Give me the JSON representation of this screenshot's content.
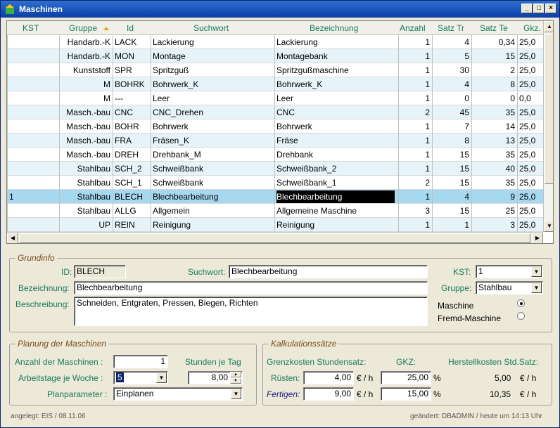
{
  "window": {
    "title": "Maschinen"
  },
  "grid": {
    "headers": [
      "KST",
      "Gruppe",
      "Id",
      "Suchwort",
      "Bezeichnung",
      "Anzahl",
      "Satz Tr",
      "Satz Te",
      "Gkz."
    ],
    "rows": [
      [
        "",
        "Handarb.-K",
        "LACK",
        "Lackierung",
        "Lackierung",
        "1",
        "4",
        "0,34",
        "25,0"
      ],
      [
        "",
        "Handarb.-K",
        "MON",
        "Montage",
        "Montagebank",
        "1",
        "5",
        "15",
        "25,0"
      ],
      [
        "",
        "Kunststoff",
        "SPR",
        "Spritzguß",
        "Spritzgußmaschine",
        "1",
        "30",
        "2",
        "25,0"
      ],
      [
        "",
        "M",
        "BOHRK",
        "Bohrwerk_K",
        "Bohrwerk_K",
        "1",
        "4",
        "8",
        "25,0"
      ],
      [
        "",
        "M",
        "---",
        "Leer",
        "Leer",
        "1",
        "0",
        "0",
        "0,0"
      ],
      [
        "",
        "Masch.-bau",
        "CNC",
        "CNC_Drehen",
        "CNC",
        "2",
        "45",
        "35",
        "25,0"
      ],
      [
        "",
        "Masch.-bau",
        "BOHR",
        "Bohrwerk",
        "Bohrwerk",
        "1",
        "7",
        "14",
        "25,0"
      ],
      [
        "",
        "Masch.-bau",
        "FRA",
        "Fräsen_K",
        "Fräse",
        "1",
        "8",
        "13",
        "25,0"
      ],
      [
        "",
        "Masch.-bau",
        "DREH",
        "Drehbank_M",
        "Drehbank",
        "1",
        "15",
        "35",
        "25,0"
      ],
      [
        "",
        "Stahlbau",
        "SCH_2",
        "Schweißbank",
        "Schweißbank_2",
        "1",
        "15",
        "40",
        "25,0"
      ],
      [
        "",
        "Stahlbau",
        "SCH_1",
        "Schweißbank",
        "Schweißbank_1",
        "2",
        "15",
        "35",
        "25,0"
      ],
      [
        "1",
        "Stahlbau",
        "BLECH",
        "Blechbearbeitung",
        "Blechbearbeitung",
        "1",
        "4",
        "9",
        "25,0"
      ],
      [
        "",
        "Stahlbau",
        "ALLG",
        "Allgemein",
        "Allgemeine Maschine",
        "3",
        "15",
        "25",
        "25,0"
      ],
      [
        "",
        "UP",
        "REIN",
        "Reinigung",
        "Reinigung",
        "1",
        "1",
        "3",
        "25,0"
      ]
    ]
  },
  "grundinfo": {
    "title": "Grundinfo",
    "id_label": "ID:",
    "id_value": "BLECH",
    "suchwort_label": "Suchwort:",
    "suchwort_value": "Blechbearbeitung",
    "kst_label": "KST:",
    "kst_value": "1",
    "bezeichnung_label": "Bezeichnung:",
    "bezeichnung_value": "Blechbearbeitung",
    "gruppe_label": "Gruppe:",
    "gruppe_value": "Stahlbau",
    "beschreibung_label": "Beschreibung:",
    "beschreibung_value": "Schneiden, Entgraten, Pressen, Biegen, Richten",
    "radio_maschine": "Maschine",
    "radio_fremd": "Fremd-Maschine"
  },
  "planung": {
    "title": "Planung der Maschinen",
    "anzahl_label": "Anzahl der Maschinen :",
    "anzahl_value": "1",
    "stunden_label": "Stunden je Tag",
    "arbeitstage_label": "Arbeitstage je Woche :",
    "arbeitstage_value": "5",
    "stunden_value": "8,00",
    "planparameter_label": "Planparameter :",
    "planparameter_value": "Einplanen"
  },
  "kalkulation": {
    "title": "Kalkulationssätze",
    "col1": "Grenzkosten Stundensatz:",
    "col2": "GKZ:",
    "col3": "Herstellkosten Std.Satz:",
    "ruesten_label": "Rüsten:",
    "ruesten_value": "4,00",
    "ruesten_gkz": "25,00",
    "ruesten_hk": "5,00",
    "fertigen_label": "Fertigen:",
    "fertigen_value": "9,00",
    "fertigen_gkz": "15,00",
    "fertigen_hk": "10,35",
    "unit_eh": "€ / h",
    "unit_pct": "%"
  },
  "footer": {
    "left": "angelegt: EIS / 08.11.06",
    "right": "geändert: DBADMIN / heute um 14:13 Uhr"
  }
}
